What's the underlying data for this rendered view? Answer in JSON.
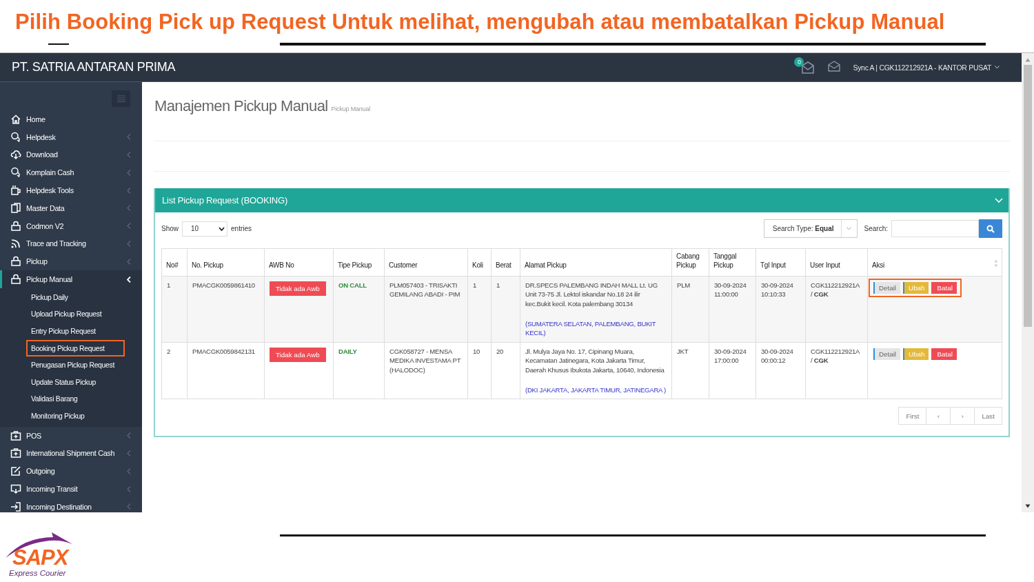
{
  "slide_title": "Pilih Booking Pick up Request Untuk melihat, mengubah atau membatalkan Pickup Manual",
  "app": {
    "brand": "PT. SATRIA ANTARAN PRIMA",
    "notification_count": "0",
    "user_menu": "Sync A | CGK112212921A - KANTOR PUSAT"
  },
  "sidebar": {
    "items": [
      {
        "label": "Home",
        "selected": false
      },
      {
        "label": "Helpdesk",
        "selected": false,
        "expanded": false
      },
      {
        "label": "Download",
        "selected": false,
        "expanded": false
      },
      {
        "label": "Komplain Cash",
        "selected": false,
        "expanded": false
      },
      {
        "label": "Helpdesk Tools",
        "selected": false,
        "expanded": false
      },
      {
        "label": "Master Data",
        "selected": false,
        "expanded": false
      },
      {
        "label": "Codmon V2",
        "selected": false,
        "expanded": false
      },
      {
        "label": "Trace and Tracking",
        "selected": false,
        "expanded": false
      },
      {
        "label": "Pickup",
        "selected": false,
        "expanded": false
      },
      {
        "label": "Pickup Manual",
        "selected": true,
        "expanded": true,
        "children": [
          {
            "label": "Pickup Daily",
            "highlighted": false
          },
          {
            "label": "Upload Pickup Request",
            "highlighted": false
          },
          {
            "label": "Entry Pickup Request",
            "highlighted": false
          },
          {
            "label": "Booking Pickup Request",
            "highlighted": true
          },
          {
            "label": "Penugasan Pickup Request",
            "highlighted": false
          },
          {
            "label": "Update Status Pickup",
            "highlighted": false
          },
          {
            "label": "Validasi Barang",
            "highlighted": false
          },
          {
            "label": "Monitoring Pickup",
            "highlighted": false
          }
        ]
      },
      {
        "label": "POS",
        "selected": false,
        "expanded": false
      },
      {
        "label": "International Shipment Cash",
        "selected": false,
        "expanded": false
      },
      {
        "label": "Outgoing",
        "selected": false,
        "expanded": false
      },
      {
        "label": "Incoming Transit",
        "selected": false,
        "expanded": false
      },
      {
        "label": "Incoming Destination",
        "selected": false,
        "expanded": false
      }
    ]
  },
  "page": {
    "title": "Manajemen Pickup Manual",
    "subtitle": "Pickup Manual"
  },
  "panel": {
    "title": "List Pickup Request (BOOKING)",
    "show_label": "Show",
    "page_size": "10",
    "entries_label": "entries",
    "search_type": "Search Type: **Equal**",
    "search_label": "Search:",
    "table": {
      "columns": [
        "No#",
        "No. Pickup",
        "AWB No",
        "Tipe Pickup",
        "Customer",
        "Koli",
        "Berat",
        "Alamat Pickup",
        "Cabang Pickup",
        "Tanggal Pickup",
        "Tgl Input",
        "User Input",
        "Aksi"
      ],
      "rows": [
        {
          "no": "1",
          "pickup_no": "PMACGK0059861410",
          "awb": "Tidak ada Awb",
          "pickup_type": "ON CALL",
          "customer": "PLM057403 - TRISAKTI GEMILANG ABADI - PIM",
          "koli": "1",
          "berat": "1",
          "address": "DR.SPECS PALEMBANG INDAH MALL Lt. UG Unit 73-75 Jl. Lektol iskandar No.18 24 ilir kec.Bukit kecil. Kota palembang 30134",
          "region": "(SUMATERA SELATAN, PALEMBANG, BUKIT KECIL)",
          "branch": "PLM",
          "pickup_date": "30-09-2024 11:00:00",
          "input_date": "30-09-2024 10:10:33",
          "user_input": "CGK112212921A / **CGK**",
          "highlighted": true,
          "actions": [
            {
              "kind": "detail",
              "label": "Detail"
            },
            {
              "kind": "edit",
              "label": "Ubah"
            },
            {
              "kind": "cancel",
              "label": "Batal"
            }
          ]
        },
        {
          "no": "2",
          "pickup_no": "PMACGK0059842131",
          "awb": "Tidak ada Awb",
          "pickup_type": "DAILY",
          "customer": "CGK058727 - MENSA MEDIKA INVESTAMA PT (HALODOC)",
          "koli": "10",
          "berat": "20",
          "address": "Jl. Mulya Jaya No. 17, Cipinang Muara, Kecamatan Jatinegara, Kota Jakarta Timur, Daerah Khusus Ibukota Jakarta, 10640, Indonesia",
          "region": "(DKI JAKARTA, JAKARTA TIMUR, JATINEGARA )",
          "branch": "JKT",
          "pickup_date": "30-09-2024 17:00:00",
          "input_date": "30-09-2024 00:00:12",
          "user_input": "CGK112212921A / **CGK**",
          "highlighted": false,
          "actions": [
            {
              "kind": "detail",
              "label": "Detail"
            },
            {
              "kind": "edit",
              "label": "Ubah"
            },
            {
              "kind": "cancel",
              "label": "Batal"
            }
          ]
        }
      ]
    },
    "pagination": [
      "First",
      "‹",
      "›",
      "Last"
    ]
  },
  "logo": {
    "name": "SAPX",
    "tagline": "Express Courier"
  }
}
